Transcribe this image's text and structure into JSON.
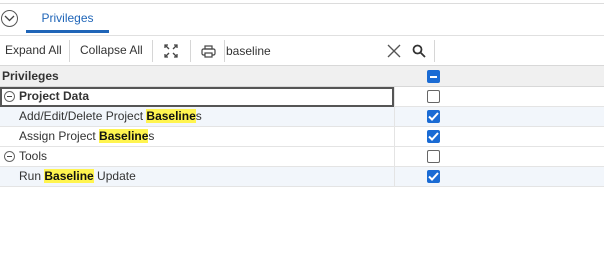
{
  "tabs": [
    {
      "label": "Privileges",
      "active": true
    }
  ],
  "toolbar": {
    "expand_all": "Expand All",
    "collapse_all": "Collapse All",
    "search_value": "baseline"
  },
  "grid": {
    "column_header": "Privileges",
    "header_checkbox_state": "indeterminate",
    "rows": [
      {
        "type": "group",
        "label": "Project Data",
        "expanded": true,
        "checked": false,
        "focused": true
      },
      {
        "type": "item",
        "pre": "Add/Edit/Delete Project ",
        "match": "Baseline",
        "post": "s",
        "checked": true
      },
      {
        "type": "item",
        "pre": "Assign Project ",
        "match": "Baseline",
        "post": "s",
        "checked": true
      },
      {
        "type": "group",
        "label": "Tools",
        "expanded": true,
        "checked": false,
        "focused": false
      },
      {
        "type": "item",
        "pre": "Run ",
        "match": "Baseline",
        "post": " Update",
        "checked": true
      }
    ]
  },
  "colors": {
    "accent": "#1f65b8",
    "checkbox": "#1a6bd4",
    "highlight": "#fff44f"
  }
}
